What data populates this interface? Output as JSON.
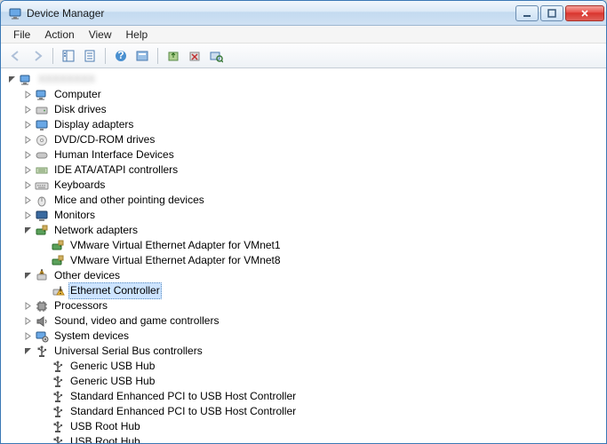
{
  "window": {
    "title": "Device Manager"
  },
  "menubar": {
    "items": [
      "File",
      "Action",
      "View",
      "Help"
    ]
  },
  "toolbar": {
    "buttons": [
      {
        "name": "back-button",
        "enabled": false,
        "icon": "arrow-left"
      },
      {
        "name": "forward-button",
        "enabled": false,
        "icon": "arrow-right"
      },
      {
        "sep": true
      },
      {
        "name": "show-hide-console-tree-button",
        "enabled": true,
        "icon": "console-tree"
      },
      {
        "name": "properties-button",
        "enabled": true,
        "icon": "properties"
      },
      {
        "sep": true
      },
      {
        "name": "help-button",
        "enabled": true,
        "icon": "help"
      },
      {
        "name": "action-button",
        "enabled": true,
        "icon": "action"
      },
      {
        "sep": true
      },
      {
        "name": "update-driver-button",
        "enabled": true,
        "icon": "update-driver"
      },
      {
        "name": "uninstall-button",
        "enabled": true,
        "icon": "uninstall"
      },
      {
        "name": "scan-hardware-button",
        "enabled": true,
        "icon": "scan-hardware"
      }
    ]
  },
  "tree": {
    "root": {
      "label": "[redacted]",
      "icon": "computer",
      "expanded": true,
      "children": [
        {
          "label": "Computer",
          "icon": "computer",
          "expandable": true
        },
        {
          "label": "Disk drives",
          "icon": "disk",
          "expandable": true
        },
        {
          "label": "Display adapters",
          "icon": "display",
          "expandable": true
        },
        {
          "label": "DVD/CD-ROM drives",
          "icon": "dvd",
          "expandable": true
        },
        {
          "label": "Human Interface Devices",
          "icon": "hid",
          "expandable": true
        },
        {
          "label": "IDE ATA/ATAPI controllers",
          "icon": "ide",
          "expandable": true
        },
        {
          "label": "Keyboards",
          "icon": "keyboard",
          "expandable": true
        },
        {
          "label": "Mice and other pointing devices",
          "icon": "mouse",
          "expandable": true
        },
        {
          "label": "Monitors",
          "icon": "monitor",
          "expandable": true
        },
        {
          "label": "Network adapters",
          "icon": "network",
          "expanded": true,
          "children": [
            {
              "label": "VMware Virtual Ethernet Adapter for VMnet1",
              "icon": "network"
            },
            {
              "label": "VMware Virtual Ethernet Adapter for VMnet8",
              "icon": "network"
            }
          ]
        },
        {
          "label": "Other devices",
          "icon": "other",
          "expanded": true,
          "children": [
            {
              "label": "Ethernet Controller",
              "icon": "other-warn",
              "selected": true
            }
          ]
        },
        {
          "label": "Processors",
          "icon": "cpu",
          "expandable": true
        },
        {
          "label": "Sound, video and game controllers",
          "icon": "sound",
          "expandable": true
        },
        {
          "label": "System devices",
          "icon": "system",
          "expandable": true
        },
        {
          "label": "Universal Serial Bus controllers",
          "icon": "usb",
          "expanded": true,
          "children": [
            {
              "label": "Generic USB Hub",
              "icon": "usb"
            },
            {
              "label": "Generic USB Hub",
              "icon": "usb"
            },
            {
              "label": "Standard Enhanced PCI to USB Host Controller",
              "icon": "usb"
            },
            {
              "label": "Standard Enhanced PCI to USB Host Controller",
              "icon": "usb"
            },
            {
              "label": "USB Root Hub",
              "icon": "usb"
            },
            {
              "label": "USB Root Hub",
              "icon": "usb"
            }
          ]
        }
      ]
    }
  }
}
